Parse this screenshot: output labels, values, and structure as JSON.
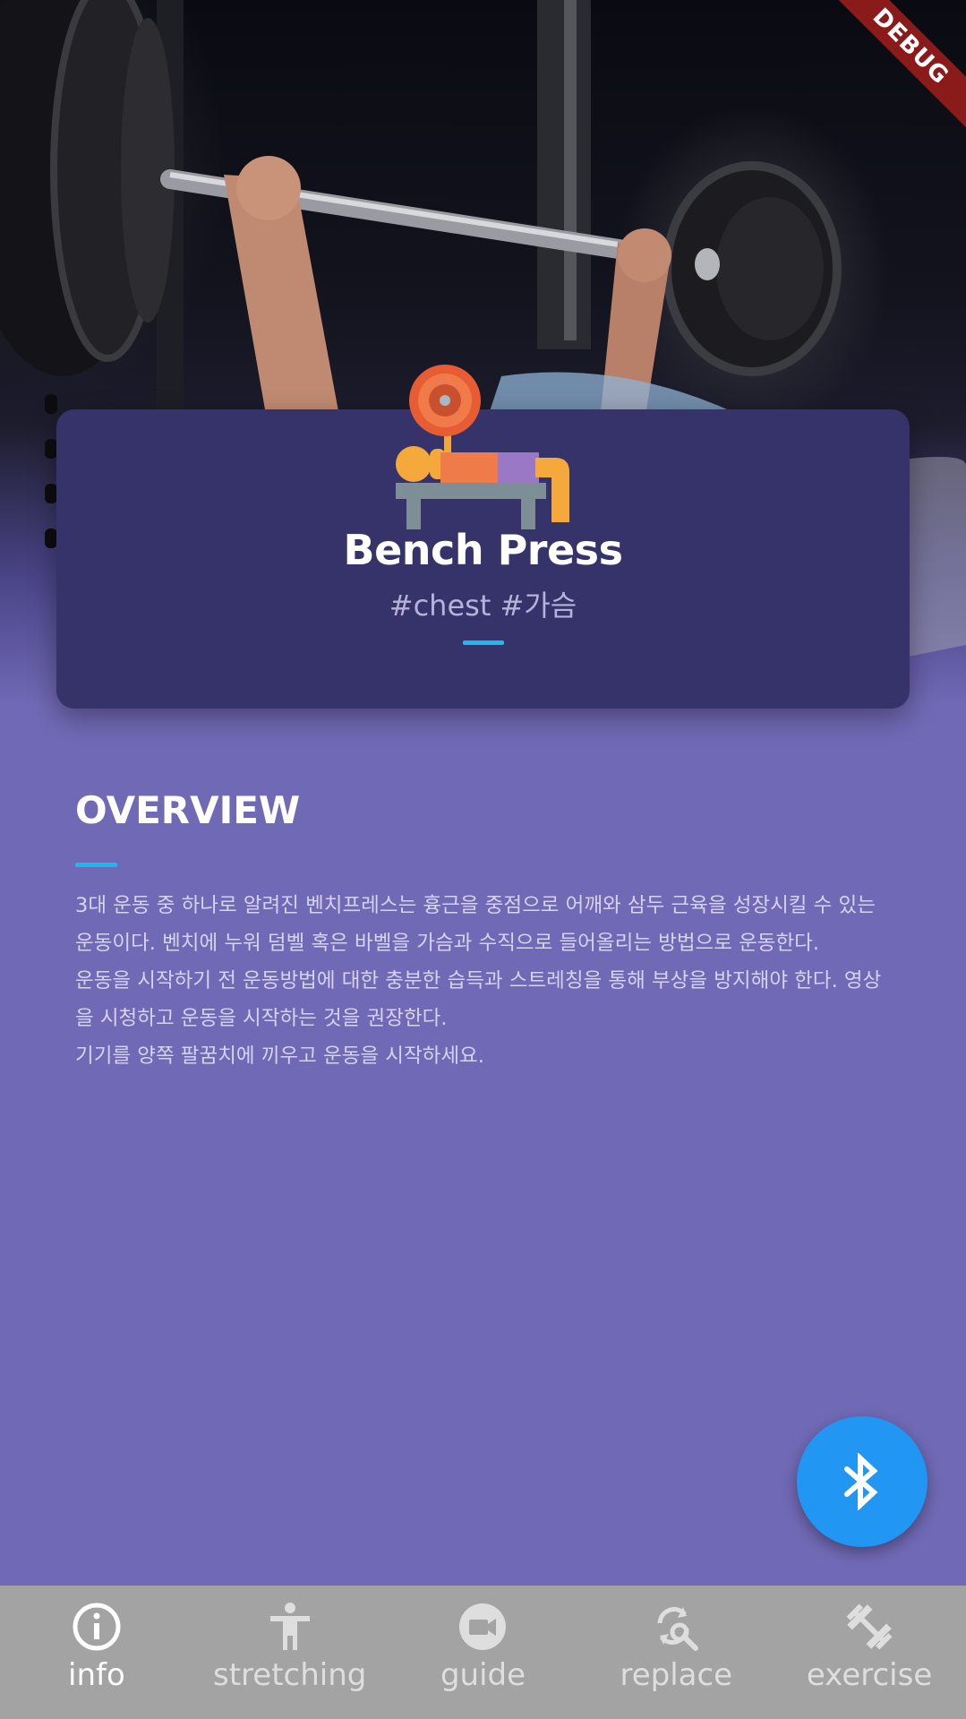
{
  "debug_banner": "DEBUG",
  "exercise": {
    "title": "Bench Press",
    "tags": "#chest #가슴",
    "icon": "bench-press-icon"
  },
  "overview": {
    "heading": "OVERVIEW",
    "paragraphs": [
      "3대 운동 중 하나로 알려진 벤치프레스는 흉근을 중점으로 어깨와 삼두 근육을 성장시킬 수 있는 운동이다. 벤치에 누워 덤벨 혹은 바벨을 가슴과 수직으로 들어올리는 방법으로 운동한다.",
      "운동을 시작하기 전 운동방법에 대한 충분한 습득과 스트레칭을 통해 부상을 방지해야 한다. 영상을 시청하고 운동을 시작하는 것을 권장한다.",
      "기기를 양쪽 팔꿈치에 끼우고 운동을 시작하세요."
    ]
  },
  "fab": {
    "icon": "bluetooth-icon"
  },
  "bottom_nav": {
    "items": [
      {
        "label": "info",
        "icon": "info-icon",
        "active": true
      },
      {
        "label": "stretching",
        "icon": "accessibility-icon",
        "active": false
      },
      {
        "label": "guide",
        "icon": "video-camera-icon",
        "active": false
      },
      {
        "label": "replace",
        "icon": "replace-search-icon",
        "active": false
      },
      {
        "label": "exercise",
        "icon": "dumbbell-icon",
        "active": false
      }
    ]
  },
  "colors": {
    "background": "#7069b5",
    "card": "#353369",
    "accent": "#1fb7f0",
    "fab": "#2196f3",
    "nav_bar": "#a3a3a3"
  }
}
